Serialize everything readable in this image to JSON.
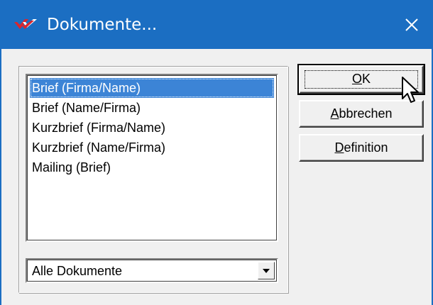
{
  "window": {
    "title": "Dokumente...",
    "app_icon": "red-checkmark-logo-icon",
    "close_icon": "close-icon",
    "titlebar_color": "#1b6ec2"
  },
  "list": {
    "items": [
      {
        "label": "Brief (Firma/Name)",
        "selected": true
      },
      {
        "label": "Brief (Name/Firma)",
        "selected": false
      },
      {
        "label": "Kurzbrief (Firma/Name)",
        "selected": false
      },
      {
        "label": "Kurzbrief (Name/Firma)",
        "selected": false
      },
      {
        "label": "Mailing (Brief)",
        "selected": false
      }
    ],
    "selection_color": "#3c84d6"
  },
  "filter": {
    "selected": "Alle Dokumente",
    "arrow_icon": "dropdown-arrow-icon"
  },
  "buttons": {
    "ok": {
      "mnemonic": "O",
      "rest": "K"
    },
    "cancel": {
      "mnemonic": "A",
      "rest": "bbrechen"
    },
    "definition": {
      "mnemonic": "D",
      "rest": "efinition"
    }
  },
  "cursor_icon": "mouse-pointer-icon"
}
